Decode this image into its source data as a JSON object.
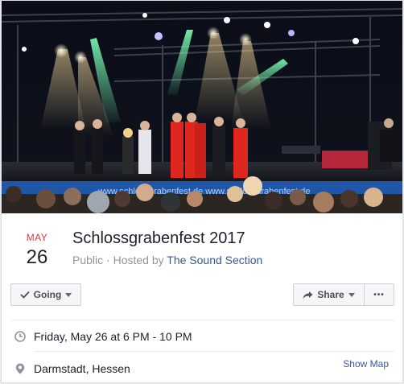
{
  "event": {
    "month": "MAY",
    "day": "26",
    "title": "Schlossgrabenfest 2017",
    "visibility": "Public",
    "hosted_by_prefix": " · Hosted by ",
    "host": "The Sound Section"
  },
  "actions": {
    "going_label": "Going",
    "share_label": "Share",
    "more_label": "•••"
  },
  "details": {
    "datetime": "Friday, May 26 at 6 PM - 10 PM",
    "location": "Darmstadt, Hessen",
    "show_map_label": "Show Map"
  },
  "cover": {
    "banner_text": "www.schlossgrabenfest.de  www.schlossgrabenfest.de"
  },
  "colors": {
    "accent_link": "#365899",
    "calendar_month": "#e0393e",
    "performer_suit": "#e0271f"
  }
}
